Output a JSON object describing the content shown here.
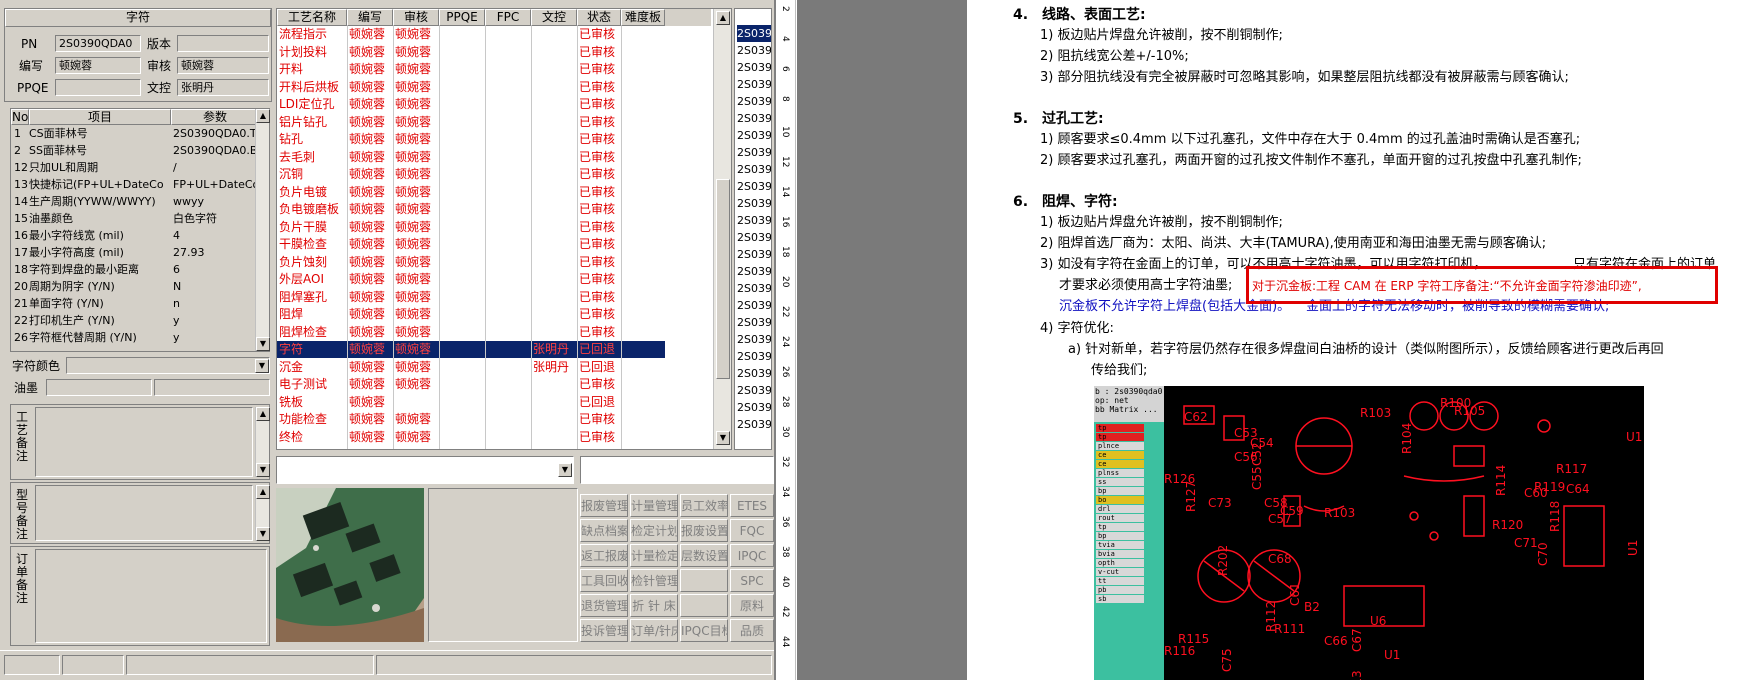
{
  "app": {
    "section_title": "字符",
    "pn_label": "PN",
    "pn_value": "2S0390QDA0",
    "version_label": "版本",
    "version_value": "",
    "author_label": "编写",
    "author_value": "顿婉蓉",
    "reviewer_label": "审核",
    "reviewer_value": "顿婉蓉",
    "ppqe_label": "PPQE",
    "ppqe_value": "",
    "doc_control_label": "文控",
    "doc_control_value": "张明丹",
    "params_headers": [
      "No",
      "项目",
      "参数"
    ],
    "params_rows": [
      {
        "no": "1",
        "item": "CS面菲林号",
        "val": "2S0390QDA0.T0"
      },
      {
        "no": "2",
        "item": "SS面菲林号",
        "val": "2S0390QDA0.B0"
      },
      {
        "no": "12",
        "item": "只加UL和周期",
        "val": "/"
      },
      {
        "no": "13",
        "item": "快捷标记(FP+UL+DateCo",
        "val": "FP+UL+DateCode"
      },
      {
        "no": "14",
        "item": "生产周期(YYWW/WWYY)",
        "val": "wwyy"
      },
      {
        "no": "15",
        "item": "油墨颜色",
        "val": "白色字符"
      },
      {
        "no": "16",
        "item": "最小字符线宽 (mil)",
        "val": "4"
      },
      {
        "no": "17",
        "item": "最小字符高度 (mil)",
        "val": "27.93"
      },
      {
        "no": "18",
        "item": "字符到焊盘的最小距离",
        "val": "6"
      },
      {
        "no": "20",
        "item": "周期为阴字 (Y/N)",
        "val": "N"
      },
      {
        "no": "21",
        "item": "单面字符 (Y/N)",
        "val": "n"
      },
      {
        "no": "22",
        "item": "打印机生产 (Y/N)",
        "val": "y"
      },
      {
        "no": "26",
        "item": "字符框代替周期 (Y/N)",
        "val": "y"
      }
    ],
    "char_color_label": "字符颜色",
    "ink_label": "油墨",
    "craft_note_label": "工艺备注",
    "model_note_label": "型号备注",
    "order_note_label": "订单备注",
    "grid_headers": [
      "工艺名称",
      "编写",
      "审核",
      "PPQE",
      "FPC",
      "文控",
      "状态",
      "难度板"
    ],
    "grid_rows": [
      {
        "name": "流程指示",
        "author": "顿婉蓉",
        "rev": "顿婉蓉",
        "dc": "",
        "status": "已审核"
      },
      {
        "name": "计划投料",
        "author": "顿婉蓉",
        "rev": "顿婉蓉",
        "dc": "",
        "status": "已审核"
      },
      {
        "name": "开料",
        "author": "顿婉蓉",
        "rev": "顿婉蓉",
        "dc": "",
        "status": "已审核"
      },
      {
        "name": "开料后烘板",
        "author": "顿婉蓉",
        "rev": "顿婉蓉",
        "dc": "",
        "status": "已审核"
      },
      {
        "name": "LDI定位孔",
        "author": "顿婉蓉",
        "rev": "顿婉蓉",
        "dc": "",
        "status": "已审核"
      },
      {
        "name": "铝片钻孔",
        "author": "顿婉蓉",
        "rev": "顿婉蓉",
        "dc": "",
        "status": "已审核"
      },
      {
        "name": "钻孔",
        "author": "顿婉蓉",
        "rev": "顿婉蓉",
        "dc": "",
        "status": "已审核"
      },
      {
        "name": "去毛刺",
        "author": "顿婉蓉",
        "rev": "顿婉蓉",
        "dc": "",
        "status": "已审核"
      },
      {
        "name": "沉铜",
        "author": "顿婉蓉",
        "rev": "顿婉蓉",
        "dc": "",
        "status": "已审核"
      },
      {
        "name": "负片电镀",
        "author": "顿婉蓉",
        "rev": "顿婉蓉",
        "dc": "",
        "status": "已审核"
      },
      {
        "name": "负电镀磨板",
        "author": "顿婉蓉",
        "rev": "顿婉蓉",
        "dc": "",
        "status": "已审核"
      },
      {
        "name": "负片干膜",
        "author": "顿婉蓉",
        "rev": "顿婉蓉",
        "dc": "",
        "status": "已审核"
      },
      {
        "name": "干膜检查",
        "author": "顿婉蓉",
        "rev": "顿婉蓉",
        "dc": "",
        "status": "已审核"
      },
      {
        "name": "负片蚀刻",
        "author": "顿婉蓉",
        "rev": "顿婉蓉",
        "dc": "",
        "status": "已审核"
      },
      {
        "name": "外层AOI",
        "author": "顿婉蓉",
        "rev": "顿婉蓉",
        "dc": "",
        "status": "已审核"
      },
      {
        "name": "阻焊塞孔",
        "author": "顿婉蓉",
        "rev": "顿婉蓉",
        "dc": "",
        "status": "已审核"
      },
      {
        "name": "阻焊",
        "author": "顿婉蓉",
        "rev": "顿婉蓉",
        "dc": "",
        "status": "已审核"
      },
      {
        "name": "阻焊检查",
        "author": "顿婉蓉",
        "rev": "顿婉蓉",
        "dc": "",
        "status": "已审核"
      },
      {
        "name": "字符",
        "author": "顿婉蓉",
        "rev": "顿婉蓉",
        "dc": "张明丹",
        "status": "已回退"
      },
      {
        "name": "沉金",
        "author": "顿婉蓉",
        "rev": "顿婉蓉",
        "dc": "张明丹",
        "status": "已回退"
      },
      {
        "name": "电子测试",
        "author": "顿婉蓉",
        "rev": "顿婉蓉",
        "dc": "",
        "status": "已审核"
      },
      {
        "name": "铣板",
        "author": "顿婉蓉",
        "rev": "",
        "dc": "",
        "status": "已回退"
      },
      {
        "name": "功能检查",
        "author": "顿婉蓉",
        "rev": "顿婉蓉",
        "dc": "",
        "status": "已审核"
      },
      {
        "name": "终检",
        "author": "顿婉蓉",
        "rev": "顿婉蓉",
        "dc": "",
        "status": "已审核"
      }
    ],
    "right_list": [
      "2S039",
      "2S039",
      "2S039",
      "2S039",
      "2S039",
      "2S039",
      "2S039",
      "2S039",
      "2S039",
      "2S039",
      "2S039",
      "2S039",
      "2S039",
      "2S039",
      "2S039",
      "2S039",
      "2S039",
      "2S039",
      "2S039",
      "2S039",
      "2S039",
      "2S039",
      "2S039",
      "2S039"
    ],
    "buttons": [
      [
        "报废管理",
        "计量管理",
        "员工效率",
        "ETES"
      ],
      [
        "缺点档案",
        "检定计划",
        "报废设置",
        "FQC"
      ],
      [
        "返工报废",
        "计量检定",
        "层数设置",
        "IPQC"
      ],
      [
        "工具回收",
        "检针管理",
        "",
        "SPC"
      ],
      [
        "退货管理",
        "折 针 床",
        "",
        "原料"
      ],
      [
        "投诉管理",
        "订单/针床",
        "IPQC目标",
        "品质"
      ]
    ]
  },
  "ruler_ticks": [
    "2",
    "4",
    "6",
    "8",
    "10",
    "12",
    "14",
    "16",
    "18",
    "20",
    "22",
    "24",
    "26",
    "28",
    "30",
    "32",
    "34",
    "36",
    "38",
    "40",
    "42",
    "44"
  ],
  "doc": {
    "s4_num": "4.",
    "s4_title": "线路、表面工艺:",
    "s4_l1": "1) 板边贴片焊盘允许被削，按不削铜制作;",
    "s4_l2": "2) 阻抗线宽公差+/-10%;",
    "s4_l3": "3) 部分阻抗线没有完全被屏蔽时可忽略其影响，如果整层阻抗线都没有被屏蔽需与顾客确认;",
    "s5_num": "5.",
    "s5_title": "过孔工艺:",
    "s5_l1": "1) 顾客要求≤0.4mm 以下过孔塞孔，文件中存在大于 0.4mm 的过孔盖油时需确认是否塞孔;",
    "s5_l2": "2) 顾客要求过孔塞孔，两面开窗的过孔按文件制作不塞孔，单面开窗的过孔按盘中孔塞孔制作;",
    "s6_num": "6.",
    "s6_title": "阻焊、字符:",
    "s6_l1": "1) 板边贴片焊盘允许被削，按不削铜制作;",
    "s6_l2": "2) 阻焊首选厂商为：太阳、尚洪、大丰(TAMURA),使用南亚和海田油墨无需与顾客确认;",
    "s6_l3a": "3) 如没有字符在金面上的订单，可以不用高士字符油墨，可以用字符打印机，",
    "s6_l3b": "只有字符在金面上的订单",
    "s6_l3c": "才要求必须使用高士字符油墨;",
    "s6_red": "对于沉金板:工程 CAM 在 ERP 字符工序备注:“不允许金面字符渗油印迹”,",
    "s6_blue1": "沉金板不允许字符上焊盘(包括大金面)。",
    "s6_blue2": "金面上的字符无法移动时，被削导致的模糊需要确认;",
    "s6_l4": "4) 字符优化:",
    "s6_a": "a) 针对新单，若字符层仍然存在很多焊盘间白油桥的设计（类似附图所示），反馈给顾客进行更改后再回",
    "s6_a2": "传给我们;"
  },
  "cad": {
    "title": "b : 2s0390qda0",
    "sub": "op: net",
    "matrix": "bb Matrix ...",
    "layers": [
      "tp",
      "tp",
      "plnce",
      "ce",
      "ce",
      "plnss",
      "ss",
      "bp",
      "bo",
      "drl",
      "rout",
      "tp",
      "bp",
      "tvia",
      "bvia",
      "opth",
      "v-cut",
      "tt",
      "pb",
      "sb"
    ],
    "labels": [
      "R103",
      "R104",
      "R105",
      "R119",
      "R114",
      "R120",
      "R117",
      "R118",
      "C64",
      "C71",
      "C70",
      "C60",
      "U1",
      "U1",
      "R100",
      "C53",
      "C52",
      "C54",
      "C56",
      "C55",
      "C73",
      "R126",
      "R127",
      "C58",
      "C59",
      "R202",
      "C57",
      "C68",
      "C61",
      "C62",
      "R103",
      "R112",
      "R115",
      "R116",
      "C75",
      "R111",
      "U6",
      "R13",
      "U1",
      "C66",
      "C67",
      "B2"
    ]
  }
}
